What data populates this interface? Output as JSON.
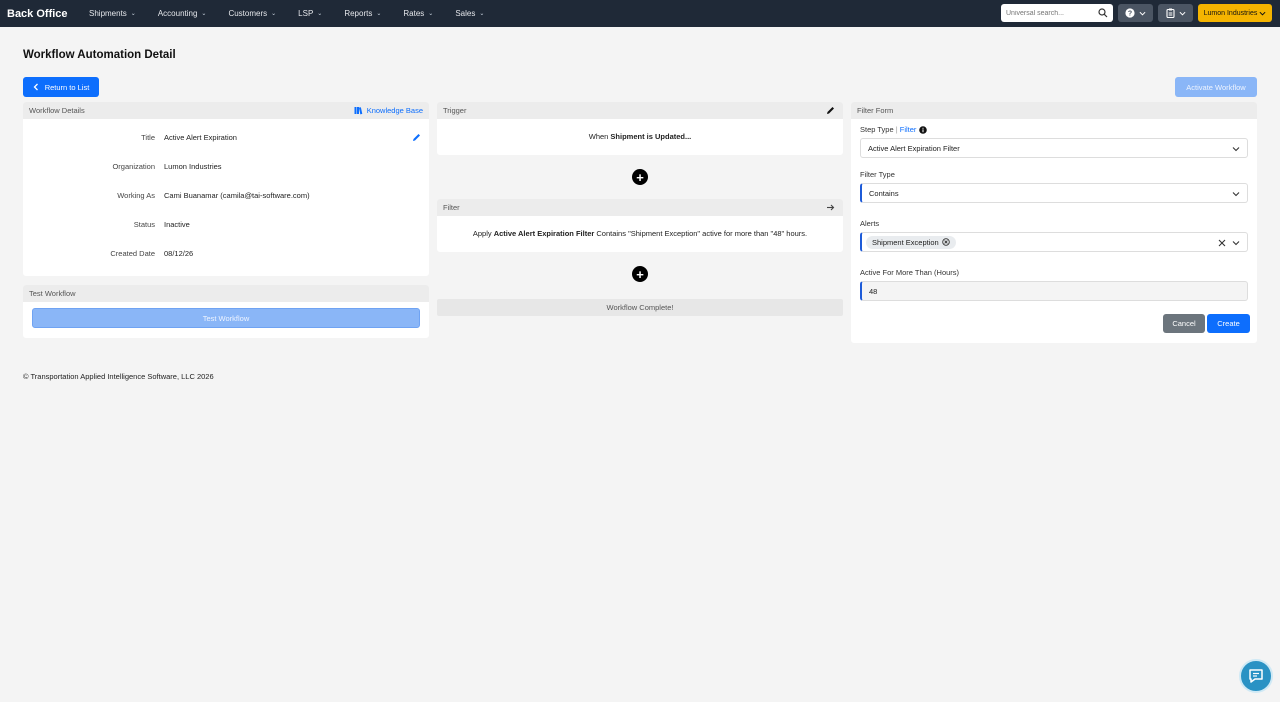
{
  "nav": {
    "brand": "Back Office",
    "items": [
      "Shipments",
      "Accounting",
      "Customers",
      "LSP",
      "Reports",
      "Rates",
      "Sales"
    ],
    "search_placeholder": "Universal search...",
    "org_label": "Lumon Industries",
    "org_color": "#f5b400"
  },
  "page": {
    "title": "Workflow Automation Detail",
    "return_label": "Return to List",
    "activate_label": "Activate Workflow"
  },
  "workflow_details": {
    "header": "Workflow Details",
    "kb_label": "Knowledge Base",
    "rows": [
      {
        "label": "Title",
        "value": "Active Alert Expiration"
      },
      {
        "label": "Organization",
        "value": "Lumon Industries"
      },
      {
        "label": "Working As",
        "value": "Cami Buanamar (camila@tai-software.com)"
      },
      {
        "label": "Status",
        "value": "Inactive"
      },
      {
        "label": "Created Date",
        "value": "08/12/26"
      }
    ]
  },
  "test_workflow": {
    "header": "Test Workflow",
    "button_label": "Test Workflow"
  },
  "trigger": {
    "header": "Trigger",
    "text_prefix": "When ",
    "text_bold": "Shipment is Updated...",
    "text_suffix": ""
  },
  "filter": {
    "header": "Filter",
    "text_prefix": "Apply ",
    "text_bold": "Active Alert Expiration Filter",
    "text_suffix": " Contains \"Shipment Exception\" active for more than \"48\" hours."
  },
  "complete": {
    "label": "Workflow Complete!"
  },
  "filter_form": {
    "header": "Filter Form",
    "step_type_label": "Step Type",
    "step_type_sep": " | ",
    "step_type_value": "Filter",
    "step_select_value": "Active Alert Expiration Filter",
    "filter_type_label": "Filter Type",
    "filter_type_value": "Contains",
    "alerts_label": "Alerts",
    "alerts_chip": "Shipment Exception",
    "active_label": "Active For More Than (Hours)",
    "active_value": "48",
    "cancel_label": "Cancel",
    "create_label": "Create"
  },
  "footer": {
    "text": "© Transportation Applied Intelligence Software, LLC 2026"
  },
  "colors": {
    "accent": "#0d6efd",
    "nav_bg": "#1f2937",
    "chat": "#2a92c4"
  }
}
